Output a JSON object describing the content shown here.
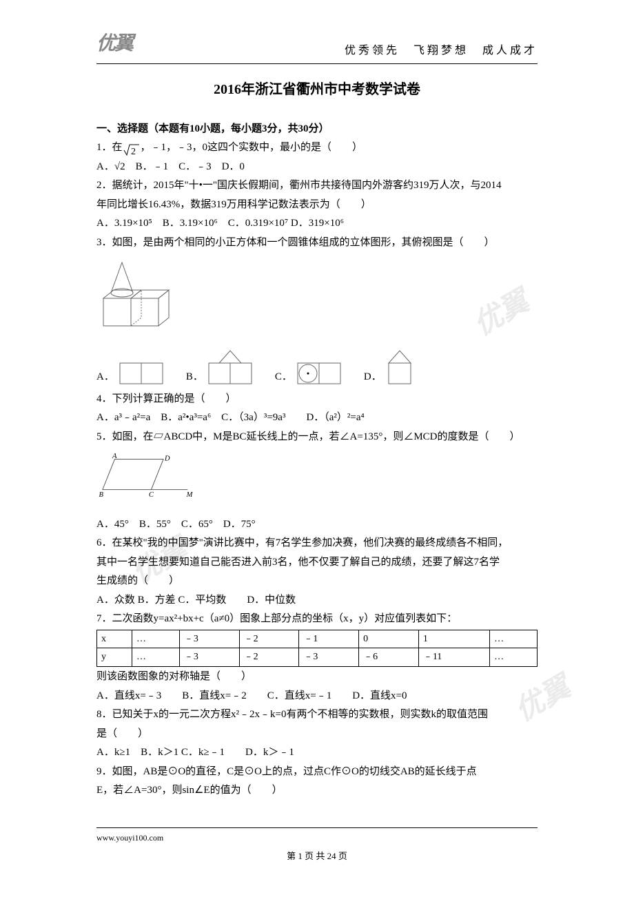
{
  "header": {
    "logo": "优翼",
    "slogan": "优秀领先　飞翔梦想　成人成才"
  },
  "title": "2016年浙江省衢州市中考数学试卷",
  "section1_title": "一、选择题（本题有10小题，每小题3分，共30分）",
  "q1": {
    "stem_a": "1．在",
    "stem_b": "，﹣1，﹣3，0这四个实数中，最小的是（　　）",
    "opts": "A．√2　B．﹣1　C．﹣3　D．0"
  },
  "q2": {
    "line1": "2．据统计，2015年\"十•一\"国庆长假期间，衢州市共接待国内外游客约319万人次，与2014",
    "line2": "年同比增长16.43%，数据319万用科学记数法表示为（　　）",
    "opts": "A．3.19×10⁵　B．3.19×10⁶　C．0.319×10⁷ D．319×10⁶"
  },
  "q3": {
    "stem": "3．如图，是由两个相同的小正方体和一个圆锥体组成的立体图形，其俯视图是（　　）",
    "optA": "A．",
    "optB": "B．",
    "optC": "C．",
    "optD": "D．"
  },
  "q4": {
    "stem": "4．下列计算正确的是（　　）",
    "opts": "A．a³﹣a²=a　B．a²•a³=a⁶　C．（3a）³=9a³　　D．（a²）²=a⁴"
  },
  "q5": {
    "stem": "5．如图，在▱ABCD中，M是BC延长线上的一点，若∠A=135°，则∠MCD的度数是（　　）",
    "labels": {
      "A": "A",
      "B": "B",
      "C": "C",
      "D": "D",
      "M": "M"
    },
    "opts": "A．45°　B．55°　C．65°　D．75°"
  },
  "q6": {
    "line1": "6．在某校\"我的中国梦\"演讲比赛中，有7名学生参加决赛，他们决赛的最终成绩各不相同，",
    "line2": "其中一名学生想要知道自己能否进入前3名，他不仅要了解自己的成绩，还要了解这7名学",
    "line3": "生成绩的（　　）",
    "opts": "A．众数 B．方差 C．平均数　　D．中位数"
  },
  "q7": {
    "stem": "7．二次函数y=ax²+bx+c（a≠0）图象上部分点的坐标（x，y）对应值列表如下：",
    "row1": [
      "x",
      "…",
      "﹣3",
      "﹣2",
      "﹣1",
      "0",
      "1",
      "…"
    ],
    "row2": [
      "y",
      "…",
      "﹣3",
      "﹣2",
      "﹣3",
      "﹣6",
      "﹣11",
      "…"
    ],
    "post": "则该函数图象的对称轴是（　　）",
    "opts": "A．直线x=﹣3　　B．直线x=﹣2　　C．直线x=﹣1　　D．直线x=0"
  },
  "q8": {
    "line1": "8．已知关于x的一元二次方程x²﹣2x﹣k=0有两个不相等的实数根，则实数k的取值范围",
    "line2": "是（　　）",
    "opts": "A．k≥1　B．k＞1 C．k≥﹣1　　D．k＞﹣1"
  },
  "q9": {
    "line1": "9．如图，AB是⊙O的直径，C是⊙O上的点，过点C作⊙O的切线交AB的延长线于点",
    "line2": "E，若∠A=30°，则sin∠E的值为（　　）"
  },
  "footer": {
    "url": "www.youyi100.com",
    "page": "第 1 页 共 24 页"
  },
  "watermark": "优翼",
  "chart_data": {
    "type": "table",
    "title": "二次函数部分点坐标",
    "columns": [
      "x",
      "y"
    ],
    "rows": [
      {
        "x": -3,
        "y": -3
      },
      {
        "x": -2,
        "y": -2
      },
      {
        "x": -1,
        "y": -3
      },
      {
        "x": 0,
        "y": -6
      },
      {
        "x": 1,
        "y": -11
      }
    ]
  }
}
